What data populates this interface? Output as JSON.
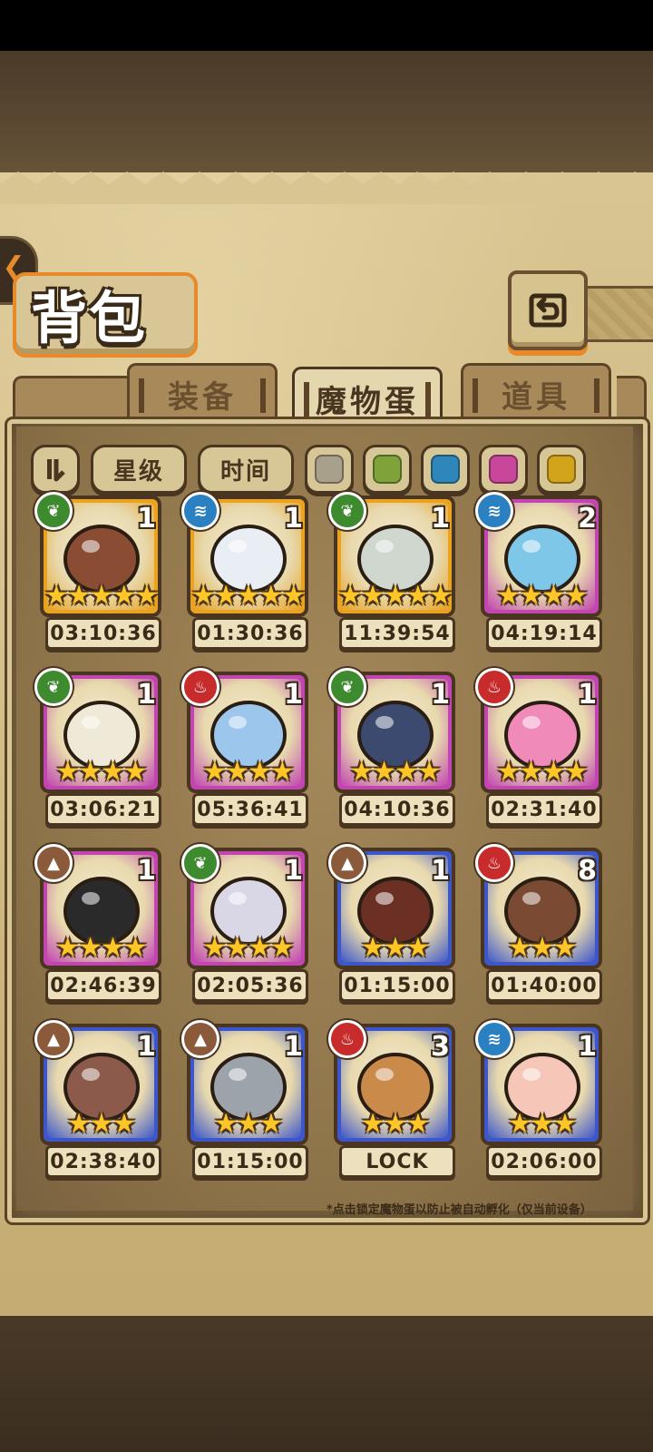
{
  "title": "背包",
  "tabs": [
    {
      "label": "装备",
      "active": false
    },
    {
      "label": "魔物蛋",
      "active": true
    },
    {
      "label": "道具",
      "active": false
    }
  ],
  "filters": {
    "sort_icon": "sort-toggle-icon",
    "star_label": "星级",
    "time_label": "时间",
    "colors": [
      "#a8a08a",
      "#7fa23a",
      "#2f86b8",
      "#c8479a",
      "#d1a41c"
    ]
  },
  "elements": {
    "grass": {
      "color": "#3e8a2f",
      "glyph": "❦"
    },
    "water": {
      "color": "#2a80c0",
      "glyph": "≋"
    },
    "fire": {
      "color": "#c72b2b",
      "glyph": "♨"
    },
    "earth": {
      "color": "#8a5a3a",
      "glyph": "▲"
    }
  },
  "rarity_colors": {
    "gold": "#e9a321",
    "purple": "#c146b0",
    "blue": "#3d57c9"
  },
  "eggs": [
    {
      "element": "grass",
      "count": "1",
      "stars": "★★★★★",
      "time": "03:10:36",
      "rarity": "gold"
    },
    {
      "element": "water",
      "count": "1",
      "stars": "★★★★★",
      "time": "01:30:36",
      "rarity": "gold"
    },
    {
      "element": "grass",
      "count": "1",
      "stars": "★★★★★",
      "time": "11:39:54",
      "rarity": "gold"
    },
    {
      "element": "water",
      "count": "2",
      "stars": "★★★★",
      "time": "04:19:14",
      "rarity": "purple"
    },
    {
      "element": "grass",
      "count": "1",
      "stars": "★★★★",
      "time": "03:06:21",
      "rarity": "purple"
    },
    {
      "element": "fire",
      "count": "1",
      "stars": "★★★★",
      "time": "05:36:41",
      "rarity": "purple"
    },
    {
      "element": "grass",
      "count": "1",
      "stars": "★★★★",
      "time": "04:10:36",
      "rarity": "purple"
    },
    {
      "element": "fire",
      "count": "1",
      "stars": "★★★★",
      "time": "02:31:40",
      "rarity": "purple"
    },
    {
      "element": "earth",
      "count": "1",
      "stars": "★★★★",
      "time": "02:46:39",
      "rarity": "purple"
    },
    {
      "element": "grass",
      "count": "1",
      "stars": "★★★★",
      "time": "02:05:36",
      "rarity": "purple"
    },
    {
      "element": "earth",
      "count": "1",
      "stars": "★★★",
      "time": "01:15:00",
      "rarity": "blue"
    },
    {
      "element": "fire",
      "count": "8",
      "stars": "★★★",
      "time": "01:40:00",
      "rarity": "blue"
    },
    {
      "element": "earth",
      "count": "1",
      "stars": "★★★",
      "time": "02:38:40",
      "rarity": "blue"
    },
    {
      "element": "earth",
      "count": "1",
      "stars": "★★★",
      "time": "01:15:00",
      "rarity": "blue"
    },
    {
      "element": "fire",
      "count": "3",
      "stars": "★★★",
      "time": "LOCK",
      "rarity": "blue"
    },
    {
      "element": "water",
      "count": "1",
      "stars": "★★★",
      "time": "02:06:00",
      "rarity": "blue"
    }
  ],
  "note": "*点击锁定魔物蛋以防止被自动孵化（仅当前设备）"
}
